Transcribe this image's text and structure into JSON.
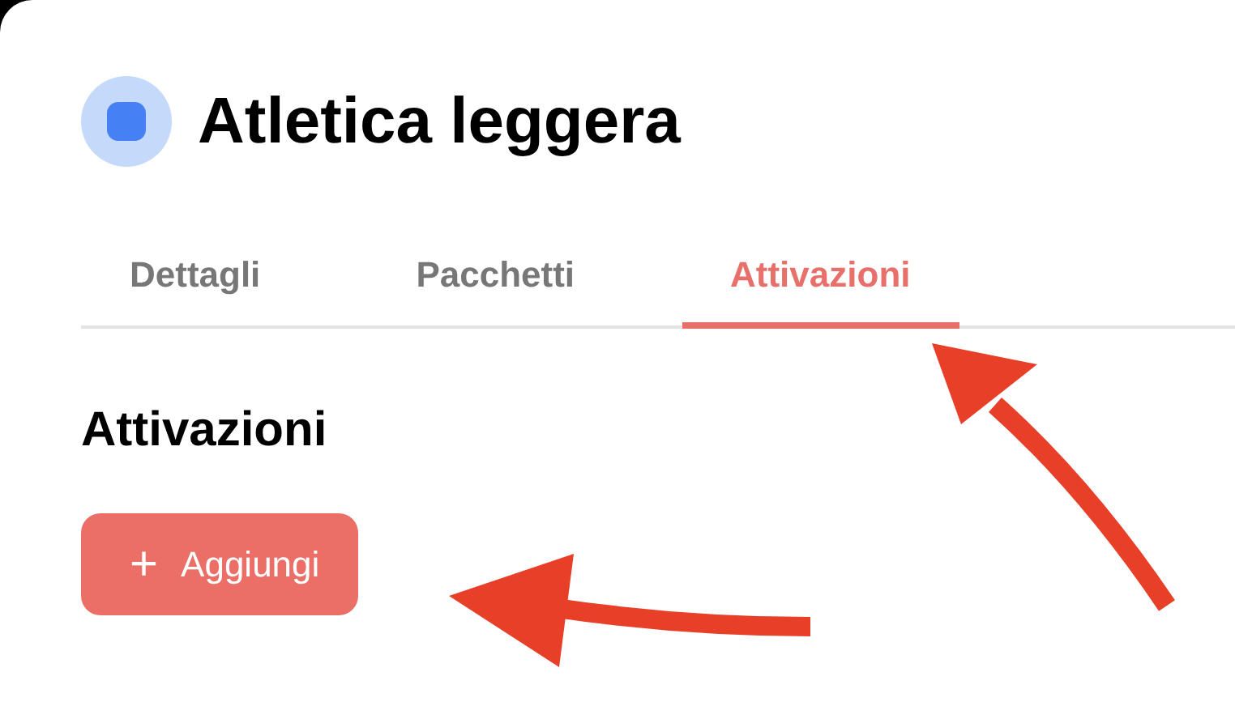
{
  "header": {
    "title": "Atletica leggera"
  },
  "tabs": [
    {
      "label": "Dettagli",
      "selected": false
    },
    {
      "label": "Pacchetti",
      "selected": false
    },
    {
      "label": "Attivazioni",
      "selected": true
    }
  ],
  "section": {
    "heading": "Attivazioni",
    "button": {
      "icon": "+",
      "label": "Aggiungi"
    }
  }
}
